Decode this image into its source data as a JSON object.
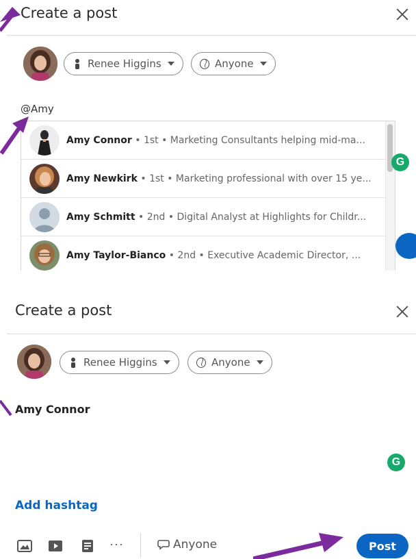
{
  "top_dialog": {
    "title": "Create a post",
    "author_pill": "Renee Higgins",
    "audience_pill": "Anyone",
    "mention_query": "@Amy",
    "suggestions": [
      {
        "name": "Amy Connor",
        "detail": " • 1st • Marketing Consultants helping mid-ma..."
      },
      {
        "name": "Amy Newkirk",
        "detail": " • 1st • Marketing professional with over 15 ye..."
      },
      {
        "name": "Amy Schmitt",
        "detail": " • 2nd • Digital Analyst at Highlights for Childr..."
      },
      {
        "name": "Amy Taylor-Bianco",
        "detail": " • 2nd • Executive Academic Director, ..."
      }
    ]
  },
  "bottom_dialog": {
    "title": "Create a post",
    "author_pill": "Renee Higgins",
    "audience_pill": "Anyone",
    "body_mention": "Amy Connor",
    "add_hashtag": "Add hashtag",
    "more_label": "···",
    "audience_small": "Anyone",
    "post_button": "Post"
  },
  "grammarly_badge": "G",
  "colors": {
    "accent": "#0a66c2",
    "annotation_arrow": "#7b2b9b",
    "grammarly": "#16a96b"
  }
}
